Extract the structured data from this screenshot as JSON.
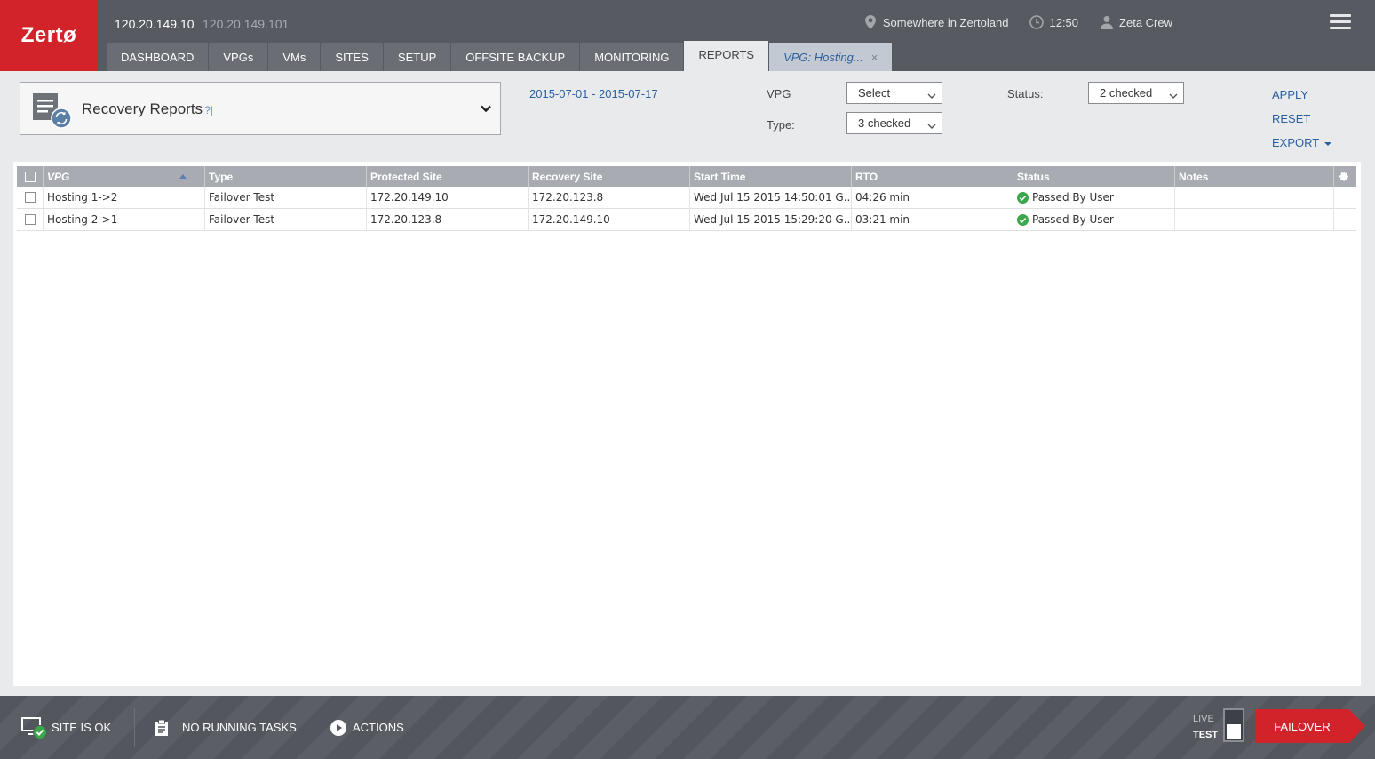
{
  "header": {
    "logo": "Zertø",
    "ip_primary": "120.20.149.10",
    "ip_secondary": "120.20.149.101",
    "location": "Somewhere in Zertoland",
    "time": "12:50",
    "user": "Zeta Crew"
  },
  "nav": {
    "tabs": [
      {
        "label": "DASHBOARD"
      },
      {
        "label": "VPGs"
      },
      {
        "label": "VMs"
      },
      {
        "label": "SITES"
      },
      {
        "label": "SETUP"
      },
      {
        "label": "OFFSITE BACKUP"
      },
      {
        "label": "MONITORING"
      },
      {
        "label": "REPORTS"
      }
    ],
    "active_tab": "REPORTS",
    "vpg_tab": {
      "label": "VPG: Hosting...",
      "close": "×"
    }
  },
  "filters": {
    "report": {
      "title": "Recovery Reports",
      "help": "|?|"
    },
    "date_range": "2015-07-01 - 2015-07-17",
    "vpg": {
      "label": "VPG",
      "value": "Select"
    },
    "type": {
      "label": "Type:",
      "value": "3 checked"
    },
    "status": {
      "label": "Status:",
      "value": "2 checked"
    },
    "apply": "APPLY",
    "reset": "RESET",
    "export": "EXPORT"
  },
  "grid": {
    "columns": [
      "VPG",
      "Type",
      "Protected Site",
      "Recovery Site",
      "Start Time",
      "RTO",
      "Status",
      "Notes"
    ],
    "sort_column": "VPG",
    "sort_direction": "ascending",
    "rows": [
      {
        "vpg": "Hosting 1->2",
        "type": "Failover Test",
        "protected": "172.20.149.10",
        "recovery": "172.20.123.8",
        "start": "Wed Jul 15 2015 14:50:01 G...",
        "rto": "04:26 min",
        "status": "Passed By User",
        "notes": ""
      },
      {
        "vpg": "Hosting 2->1",
        "type": "Failover Test",
        "protected": "172.20.123.8",
        "recovery": "172.20.149.10",
        "start": "Wed Jul 15 2015 15:29:20 G...",
        "rto": "03:21 min",
        "status": "Passed By User",
        "notes": ""
      }
    ]
  },
  "footer": {
    "site_status": "SITE IS OK",
    "tasks": "NO RUNNING TASKS",
    "actions": "ACTIONS",
    "live": "LIVE",
    "test": "TEST",
    "failover": "FAILOVER"
  },
  "colors": {
    "brand_red": "#d2232a",
    "header_gray": "#575a61",
    "link_blue": "#2c5f9e",
    "ok_green": "#3aa84a"
  },
  "icons": [
    "location-pin-icon",
    "clock-icon",
    "user-icon",
    "hamburger-menu-icon",
    "recovery-report-icon",
    "chevron-down-icon",
    "sort-asc-icon",
    "gear-icon",
    "check-circle-icon",
    "monitor-check-icon",
    "clipboard-icon",
    "play-circle-icon"
  ]
}
